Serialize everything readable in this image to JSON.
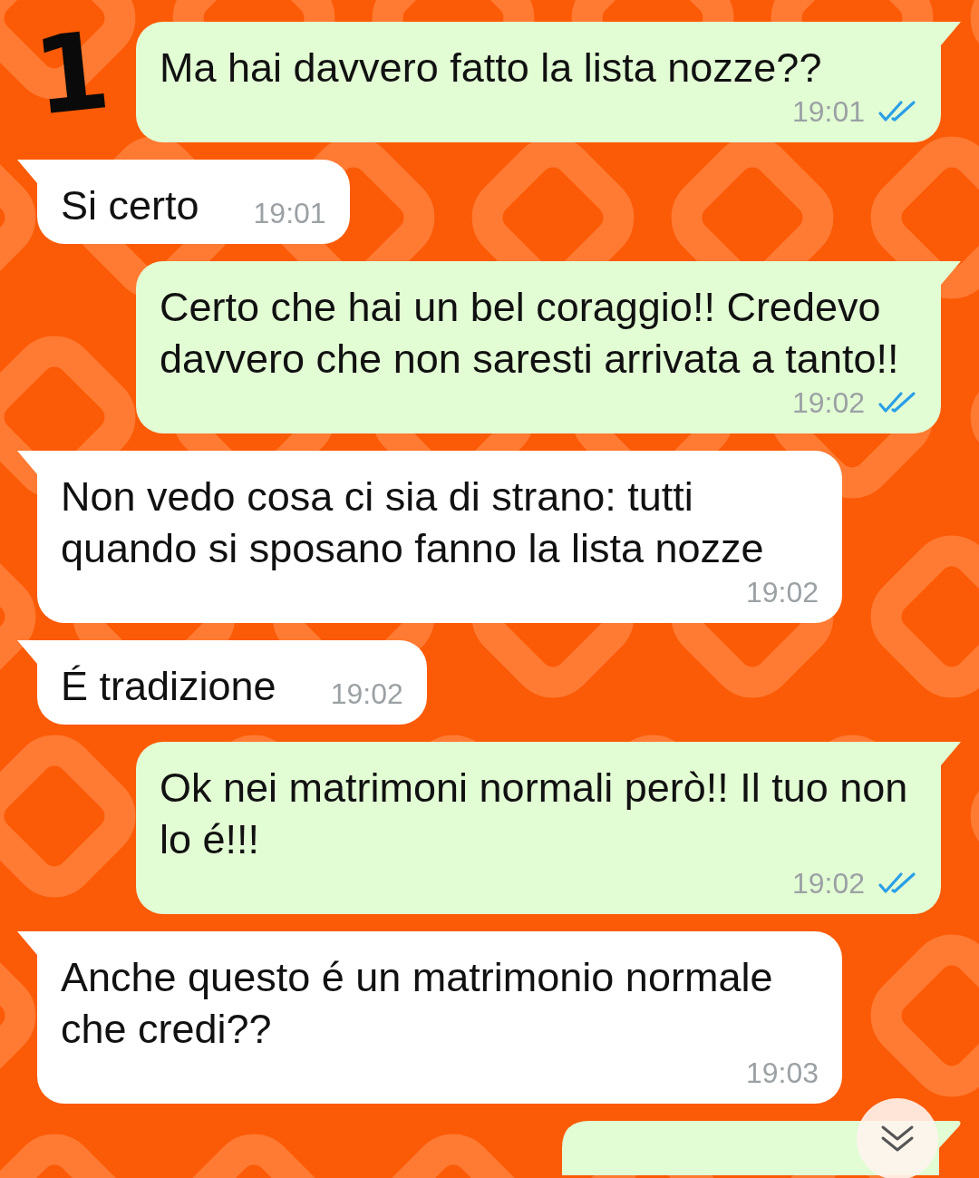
{
  "annotation": "1",
  "messages": [
    {
      "kind": "outgoing",
      "text": "Ma hai davvero fatto la lista nozze??",
      "time": "19:01",
      "read": true
    },
    {
      "kind": "incoming",
      "text": "Si certo",
      "time": "19:01"
    },
    {
      "kind": "outgoing",
      "text": "Certo che hai un bel coraggio!! Credevo davvero che non saresti arrivata a tanto!!",
      "time": "19:02",
      "read": true
    },
    {
      "kind": "incoming",
      "text": "Non vedo cosa ci sia di strano: tutti quando si sposano fanno la lista nozze",
      "time": "19:02"
    },
    {
      "kind": "incoming",
      "text": "É tradizione",
      "time": "19:02"
    },
    {
      "kind": "outgoing",
      "text": "Ok nei matrimoni normali però!! Il tuo non lo é!!!",
      "time": "19:02",
      "read": true
    },
    {
      "kind": "incoming",
      "text": "Anche questo é un matrimonio normale che credi??",
      "time": "19:03"
    }
  ]
}
